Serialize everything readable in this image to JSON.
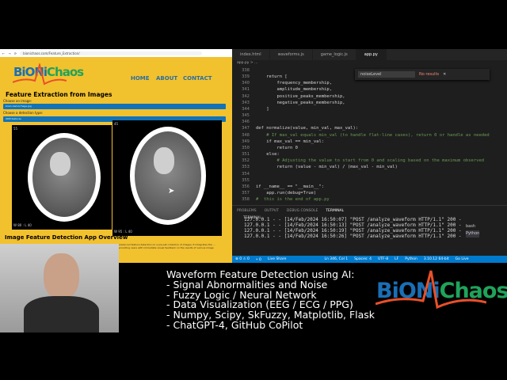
{
  "browser": {
    "url": "bionichaos.com/Feature_Extraction/",
    "logo": {
      "part1": "BiONi",
      "part2": "Chaos"
    },
    "nav": [
      "HOME",
      "ABOUT",
      "CONTACT"
    ],
    "title": "Feature Extraction from Images",
    "choose_image_label": "Choose an image:",
    "image_value": "brain-hemorrhage.jpg",
    "choose_detection_label": "Choose a detection type:",
    "detection_value": "ORB features",
    "ct_left": {
      "top": "55",
      "bottom": "W 80 : L 40"
    },
    "ct_right": {
      "top": "45",
      "bottom": "W 95 : L 40"
    },
    "overview_title": "Image Feature Detection App Overview",
    "overview_text": "advanced feature detection on a pre-set collection of images. It integrates the ... providing users with immediate visual feedback on the results of various image"
  },
  "editor": {
    "tabs": [
      "index.html",
      "waveforms.js",
      "game_logic.js",
      "app.py"
    ],
    "breadcrumb": "app.py > ...",
    "find": {
      "query": "noiseLevel",
      "result": "No results"
    },
    "lines": [
      [
        "338",
        ""
      ],
      [
        "339",
        "    return ["
      ],
      [
        "340",
        "        frequency_membership,"
      ],
      [
        "341",
        "        amplitude_membership,"
      ],
      [
        "342",
        "        positive_peaks_membership,"
      ],
      [
        "343",
        "        negative_peaks_membership,"
      ],
      [
        "344",
        "    ]"
      ],
      [
        "345",
        ""
      ],
      [
        "346",
        ""
      ],
      [
        "347",
        "def normalize(value, min_val, max_val):"
      ],
      [
        "348",
        "    # If max_val equals min_val (to handle flat-line cases), return 0 or handle as needed"
      ],
      [
        "349",
        "    if max_val == min_val:"
      ],
      [
        "350",
        "        return 0"
      ],
      [
        "351",
        "    else:"
      ],
      [
        "352",
        "        # Adjusting the value to start from 0 and scaling based on the maximum observed"
      ],
      [
        "353",
        "        return (value - min_val) / (max_val - min_val)"
      ],
      [
        "354",
        ""
      ],
      [
        "355",
        ""
      ],
      [
        "356",
        "if __name__ == \"__main__\":"
      ],
      [
        "357",
        "    app.run(debug=True)"
      ],
      [
        "358",
        "#  this is the end of app.py"
      ]
    ],
    "panel_tabs": [
      "PROBLEMS",
      "OUTPUT",
      "DEBUG CONSOLE",
      "TERMINAL"
    ],
    "terminal_header": "TERMINAL",
    "terminal_lines": [
      "127.0.0.1 - - [14/Feb/2024 16:50:07] \"POST /analyze_waveform HTTP/1.1\" 200 -",
      "127.0.0.1 - - [14/Feb/2024 16:50:13] \"POST /analyze_waveform HTTP/1.1\" 200 -",
      "127.0.0.1 - - [14/Feb/2024 16:50:19] \"POST /analyze_waveform HTTP/1.1\" 200 -",
      "127.0.0.1 - - [14/Feb/2024 16:50:26] \"POST /analyze_waveform HTTP/1.1\" 200 -"
    ],
    "shells": [
      "bash",
      "Python"
    ],
    "status": [
      "⊗ 0 ⚠ 0",
      "⑂ 0",
      "Live Share",
      "Ln 346, Col 1",
      "Spaces: 4",
      "UTF-8",
      "LF",
      "Python",
      "3.10.12 64-bit",
      "Go Live"
    ]
  },
  "caption": "Waveform Feature Detection using AI:\n- Signal Abnormalities and Noise\n- Fuzzy Logic / Neural Network\n- Data Visualization (EEG / ECG / PPG)\n- Numpy, Scipy, SkFuzzy, Matplotlib, Flask\n- ChatGPT-4, GitHub CoPilot",
  "brand_logo": {
    "part1": "BiONi",
    "part2": "Chaos"
  }
}
